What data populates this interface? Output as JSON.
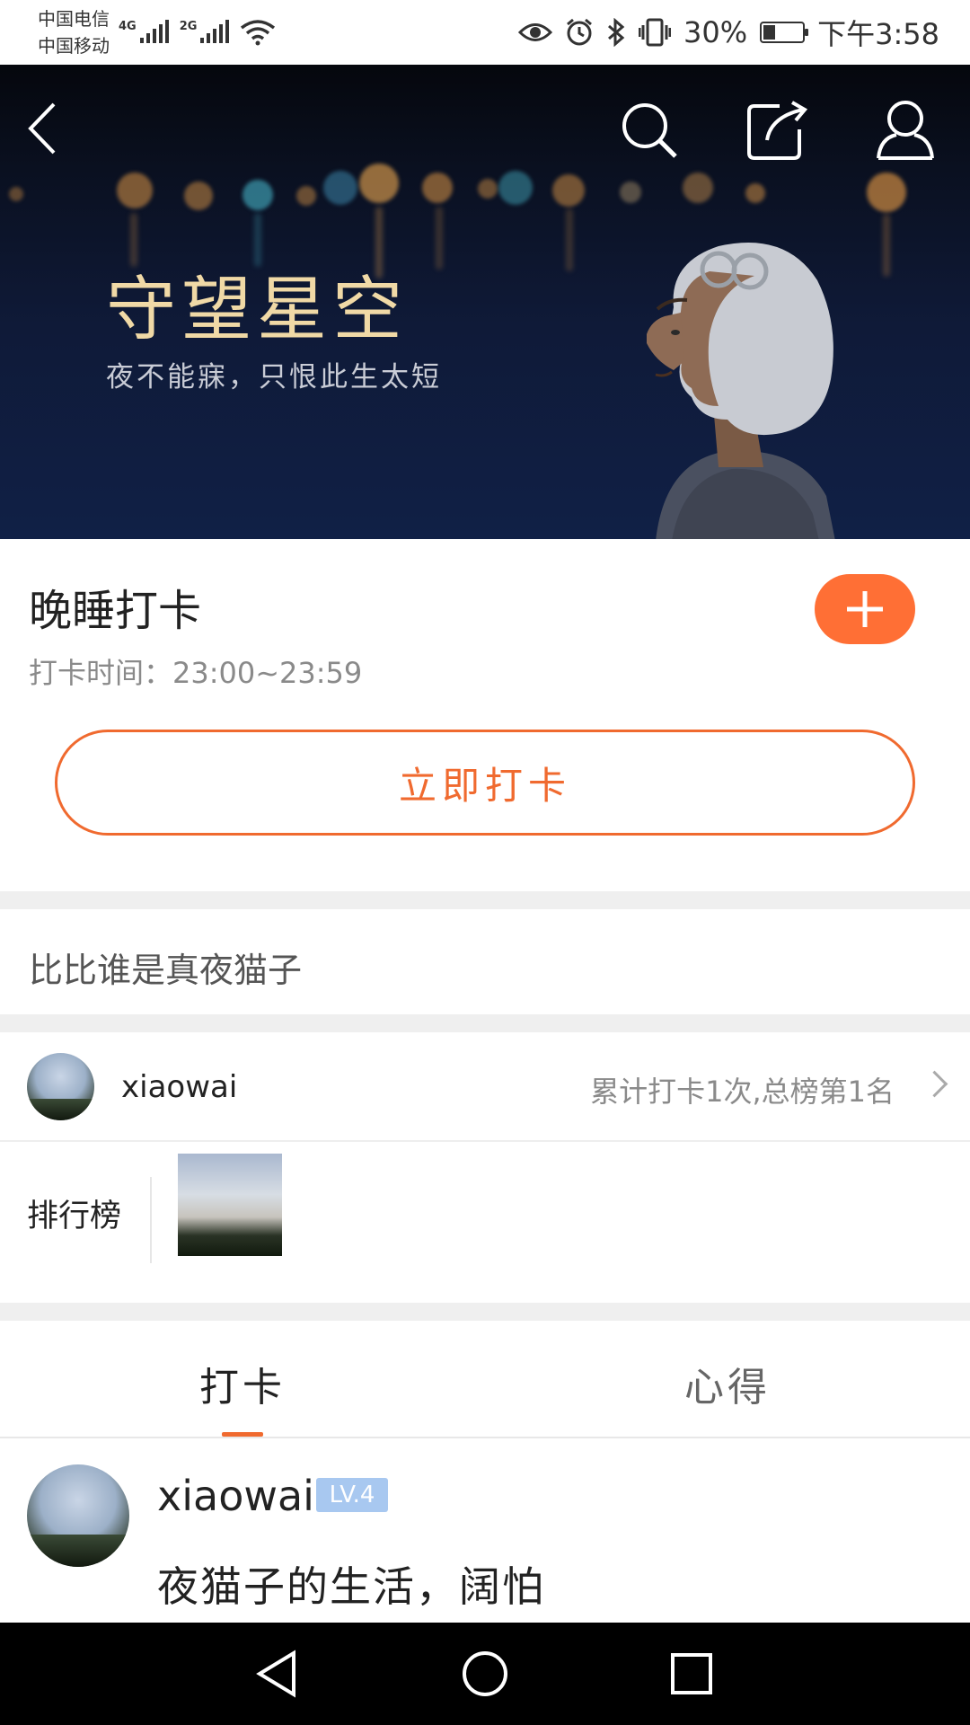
{
  "status_bar": {
    "carrier_1": "中国电信",
    "carrier_2": "中国移动",
    "signal_1_label": "4G",
    "signal_2_label": "2G",
    "battery": "30%",
    "battery_level": 0.3,
    "time": "下午3:58",
    "icons": [
      "eye-icon",
      "alarm-icon",
      "bluetooth-icon",
      "vibrate-icon",
      "battery-icon"
    ]
  },
  "banner": {
    "title": "守望星空",
    "subtitle": "夜不能寐，只恨此生太短",
    "icons": [
      "back-icon",
      "search-icon",
      "share-icon",
      "user-icon"
    ]
  },
  "checkin": {
    "title": "晚睡打卡",
    "time_label": "打卡时间：",
    "time_value": "23:00~23:59",
    "button": "立即打卡"
  },
  "ranking": {
    "heading": "比比谁是真夜猫子",
    "user_name": "xiaowai",
    "stats": "累计打卡1次,总榜第1名",
    "board_label": "排行榜"
  },
  "tabs": [
    {
      "label": "打卡",
      "active": true
    },
    {
      "label": "心得",
      "active": false
    }
  ],
  "post": {
    "user_name": "xiaowai",
    "level": "LV.4",
    "text": "夜猫子的生活，阔怕"
  },
  "colors": {
    "accent": "#f06a2f",
    "plus_button": "#ff6f35",
    "level_badge": "#a8c8f0"
  }
}
